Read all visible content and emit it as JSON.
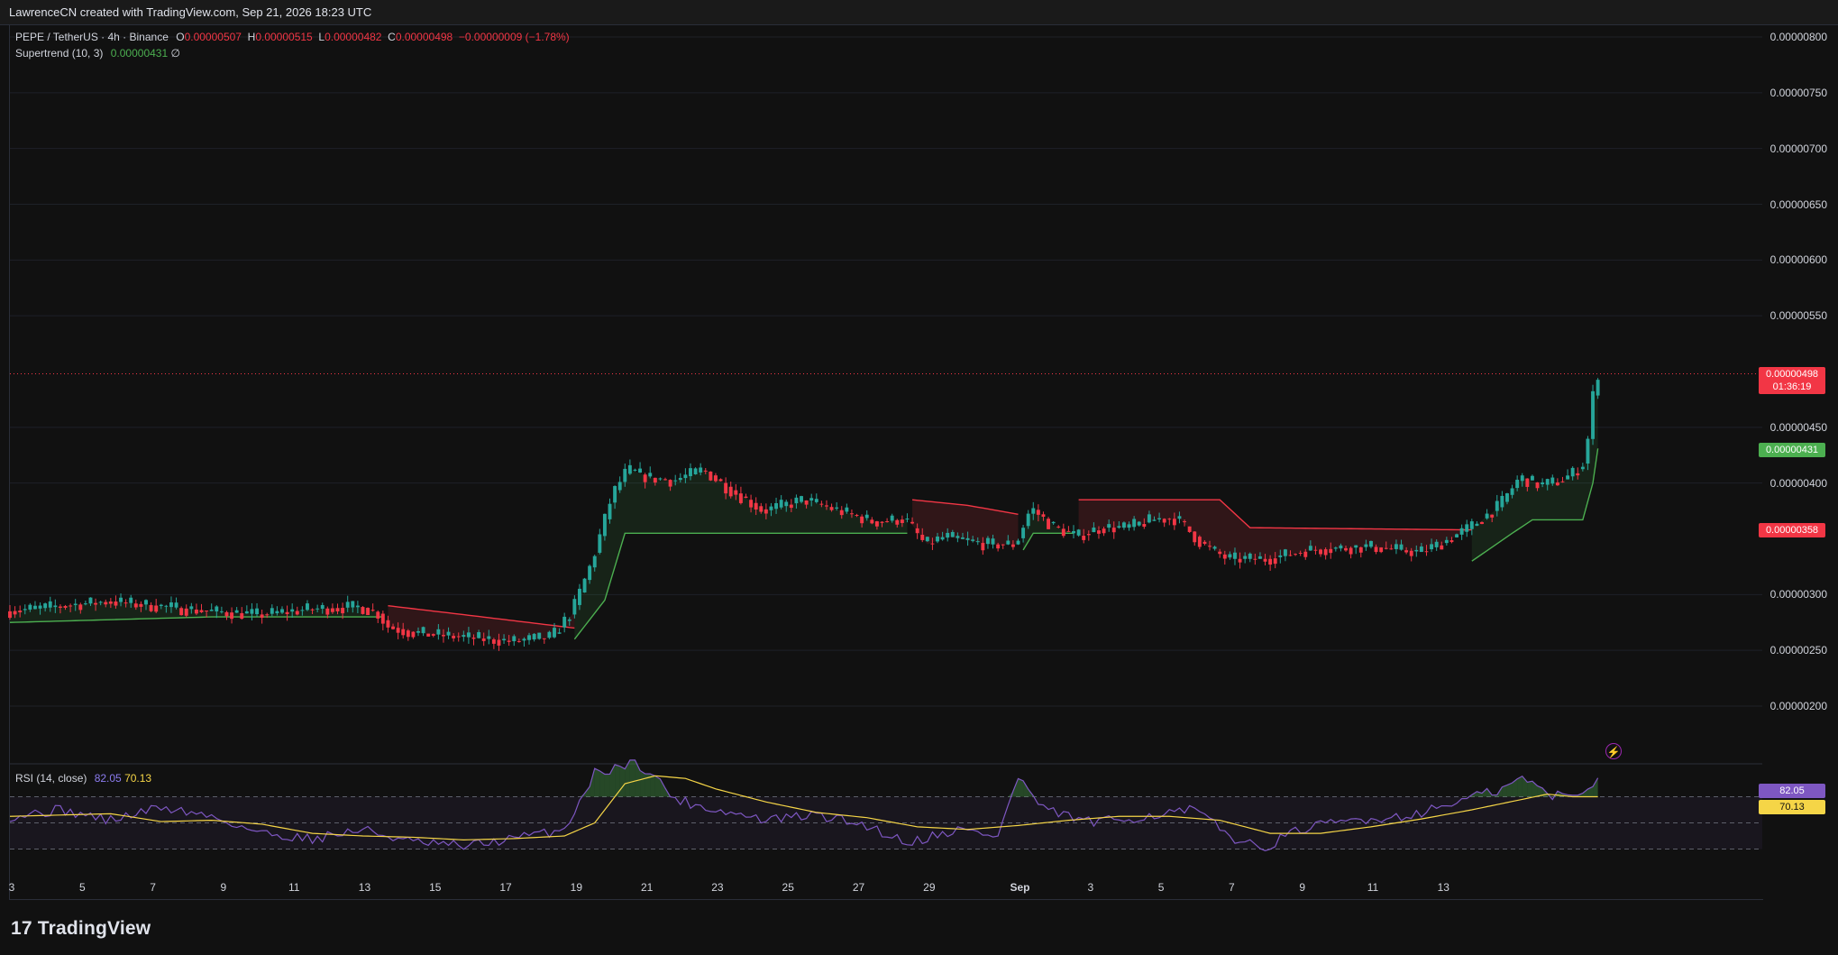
{
  "header": {
    "text": "LawrenceCN created with TradingView.com, Sep 21, 2026 18:23 UTC"
  },
  "legend": {
    "symbol": "PEPE / TetherUS · 4h · Binance",
    "o_key": "O",
    "o": "0.00000507",
    "h_key": "H",
    "h": "0.00000515",
    "l_key": "L",
    "l": "0.00000482",
    "c_key": "C",
    "c": "0.00000498",
    "change": "−0.00000009 (−1.78%)",
    "supertrend_label": "Supertrend (10, 3)",
    "supertrend_value": "0.00000431",
    "supertrend_extra": "∅",
    "rsi_label": "RSI (14, close)",
    "rsi_value": "82.05",
    "rsi_ma_value": "70.13"
  },
  "price_axis": {
    "ticks": [
      "0.00000800",
      "0.00000750",
      "0.00000700",
      "0.00000650",
      "0.00000600",
      "0.00000550",
      "0.00000450",
      "0.00000400",
      "0.00000300",
      "0.00000250",
      "0.00000200"
    ]
  },
  "tags": {
    "last_price": "0.00000498",
    "countdown": "01:36:19",
    "supertrend_up": "0.00000431",
    "supertrend_down": "0.00000358",
    "rsi": "82.05",
    "rsi_ma": "70.13"
  },
  "time_axis": {
    "labels": [
      "3",
      "5",
      "7",
      "9",
      "11",
      "13",
      "15",
      "17",
      "19",
      "21",
      "23",
      "25",
      "27",
      "29",
      "Sep",
      "3",
      "5",
      "7",
      "9",
      "11",
      "13"
    ]
  },
  "branding": {
    "logo_mark": "17",
    "logo_text": "TradingView"
  },
  "colors": {
    "up": "#26a69a",
    "down": "#f23645",
    "supertrend_up": "#4caf50",
    "supertrend_down": "#f23645",
    "rsi": "#7e57c2",
    "rsi_ma": "#f5d547",
    "background": "#111111"
  },
  "chart_data": [
    {
      "type": "candlestick",
      "title": "PEPE / TetherUS · 4h · Binance",
      "ylim": [
        1.7e-06,
        8.2e-06
      ],
      "x_labels": [
        "3",
        "5",
        "7",
        "9",
        "11",
        "13",
        "15",
        "17",
        "19",
        "21",
        "23",
        "25",
        "27",
        "29",
        "Sep",
        "3",
        "5",
        "7",
        "9",
        "11",
        "13"
      ],
      "price_path": [
        [
          0,
          2.85e-06
        ],
        [
          20,
          2.94e-06
        ],
        [
          40,
          2.85e-06
        ],
        [
          50,
          2.82e-06
        ],
        [
          60,
          2.87e-06
        ],
        [
          70,
          2.89e-06
        ],
        [
          74,
          2.82e-06
        ],
        [
          75,
          2.72e-06
        ],
        [
          80,
          2.66e-06
        ],
        [
          90,
          2.62e-06
        ],
        [
          100,
          2.58e-06
        ],
        [
          108,
          2.62e-06
        ],
        [
          112,
          2.85e-06
        ],
        [
          116,
          3.3e-06
        ],
        [
          120,
          3.9e-06
        ],
        [
          123,
          4.12e-06
        ],
        [
          127,
          4.05e-06
        ],
        [
          132,
          4.02e-06
        ],
        [
          138,
          4.12e-06
        ],
        [
          143,
          3.95e-06
        ],
        [
          150,
          3.75e-06
        ],
        [
          158,
          3.85e-06
        ],
        [
          165,
          3.75e-06
        ],
        [
          172,
          3.65e-06
        ],
        [
          178,
          3.68e-06
        ],
        [
          182,
          3.45e-06
        ],
        [
          186,
          3.52e-06
        ],
        [
          194,
          3.45e-06
        ],
        [
          200,
          3.45e-06
        ],
        [
          203,
          3.78e-06
        ],
        [
          207,
          3.62e-06
        ],
        [
          212,
          3.52e-06
        ],
        [
          217,
          3.6e-06
        ],
        [
          222,
          3.6e-06
        ],
        [
          228,
          3.68e-06
        ],
        [
          232,
          3.68e-06
        ],
        [
          237,
          3.45e-06
        ],
        [
          242,
          3.32e-06
        ],
        [
          250,
          3.32e-06
        ],
        [
          258,
          3.4e-06
        ],
        [
          270,
          3.43e-06
        ],
        [
          280,
          3.38e-06
        ],
        [
          284,
          3.45e-06
        ],
        [
          290,
          3.6e-06
        ],
        [
          296,
          3.8e-06
        ],
        [
          300,
          4.05e-06
        ],
        [
          304,
          3.98e-06
        ],
        [
          308,
          4.02e-06
        ],
        [
          311,
          4.1e-06
        ],
        [
          313,
          4.2e-06
        ],
        [
          315,
          4.98e-06
        ]
      ],
      "supertrend_segments": [
        {
          "direction": "up",
          "points": [
            [
              0,
              2.75e-06
            ],
            [
              40,
              2.8e-06
            ],
            [
              74,
              2.8e-06
            ]
          ]
        },
        {
          "direction": "down",
          "points": [
            [
              75,
              2.9e-06
            ],
            [
              90,
              2.82e-06
            ],
            [
              112,
              2.7e-06
            ]
          ]
        },
        {
          "direction": "up",
          "points": [
            [
              112,
              2.6e-06
            ],
            [
              118,
              2.95e-06
            ],
            [
              122,
              3.55e-06
            ],
            [
              178,
              3.55e-06
            ]
          ]
        },
        {
          "direction": "down",
          "points": [
            [
              179,
              3.85e-06
            ],
            [
              190,
              3.8e-06
            ],
            [
              200,
              3.72e-06
            ]
          ]
        },
        {
          "direction": "up",
          "points": [
            [
              201,
              3.4e-06
            ],
            [
              203,
              3.55e-06
            ],
            [
              211,
              3.55e-06
            ]
          ]
        },
        {
          "direction": "down",
          "points": [
            [
              212,
              3.85e-06
            ],
            [
              240,
              3.85e-06
            ],
            [
              246,
              3.6e-06
            ],
            [
              290,
              3.58e-06
            ]
          ]
        },
        {
          "direction": "up",
          "points": [
            [
              290,
              3.3e-06
            ],
            [
              298,
              3.55e-06
            ],
            [
              302,
              3.67e-06
            ],
            [
              312,
              3.67e-06
            ],
            [
              314,
              4e-06
            ],
            [
              315,
              4.31e-06
            ]
          ]
        }
      ]
    },
    {
      "type": "line",
      "title": "RSI (14, close)",
      "ylim": [
        0,
        100
      ],
      "reference_levels": [
        70,
        50,
        30
      ],
      "series": [
        {
          "name": "RSI",
          "values": [
            [
              0,
              55
            ],
            [
              10,
              60
            ],
            [
              20,
              52
            ],
            [
              30,
              62
            ],
            [
              40,
              55
            ],
            [
              50,
              42
            ],
            [
              60,
              38
            ],
            [
              70,
              45
            ],
            [
              80,
              35
            ],
            [
              90,
              32
            ],
            [
              100,
              38
            ],
            [
              110,
              45
            ],
            [
              116,
              88
            ],
            [
              120,
              92
            ],
            [
              124,
              97
            ],
            [
              128,
              85
            ],
            [
              132,
              68
            ],
            [
              140,
              60
            ],
            [
              150,
              52
            ],
            [
              160,
              56
            ],
            [
              170,
              48
            ],
            [
              178,
              35
            ],
            [
              188,
              45
            ],
            [
              196,
              40
            ],
            [
              200,
              85
            ],
            [
              205,
              60
            ],
            [
              215,
              50
            ],
            [
              225,
              55
            ],
            [
              235,
              60
            ],
            [
              242,
              40
            ],
            [
              248,
              30
            ],
            [
              256,
              45
            ],
            [
              266,
              52
            ],
            [
              276,
              55
            ],
            [
              282,
              60
            ],
            [
              290,
              70
            ],
            [
              296,
              75
            ],
            [
              300,
              85
            ],
            [
              305,
              72
            ],
            [
              310,
              70
            ],
            [
              313,
              78
            ],
            [
              315,
              82
            ]
          ]
        },
        {
          "name": "RSI-based MA",
          "values": [
            [
              0,
              55
            ],
            [
              20,
              57
            ],
            [
              30,
              51
            ],
            [
              40,
              52
            ],
            [
              50,
              49
            ],
            [
              60,
              42
            ],
            [
              70,
              40
            ],
            [
              80,
              39
            ],
            [
              90,
              37
            ],
            [
              100,
              38
            ],
            [
              110,
              40
            ],
            [
              116,
              50
            ],
            [
              122,
              80
            ],
            [
              128,
              86
            ],
            [
              134,
              84
            ],
            [
              140,
              76
            ],
            [
              150,
              66
            ],
            [
              160,
              58
            ],
            [
              170,
              54
            ],
            [
              180,
              47
            ],
            [
              190,
              45
            ],
            [
              200,
              48
            ],
            [
              210,
              52
            ],
            [
              220,
              55
            ],
            [
              230,
              55
            ],
            [
              240,
              52
            ],
            [
              250,
              42
            ],
            [
              260,
              42
            ],
            [
              270,
              47
            ],
            [
              280,
              53
            ],
            [
              290,
              60
            ],
            [
              300,
              68
            ],
            [
              305,
              72
            ],
            [
              310,
              70
            ],
            [
              315,
              70
            ]
          ]
        }
      ]
    }
  ]
}
